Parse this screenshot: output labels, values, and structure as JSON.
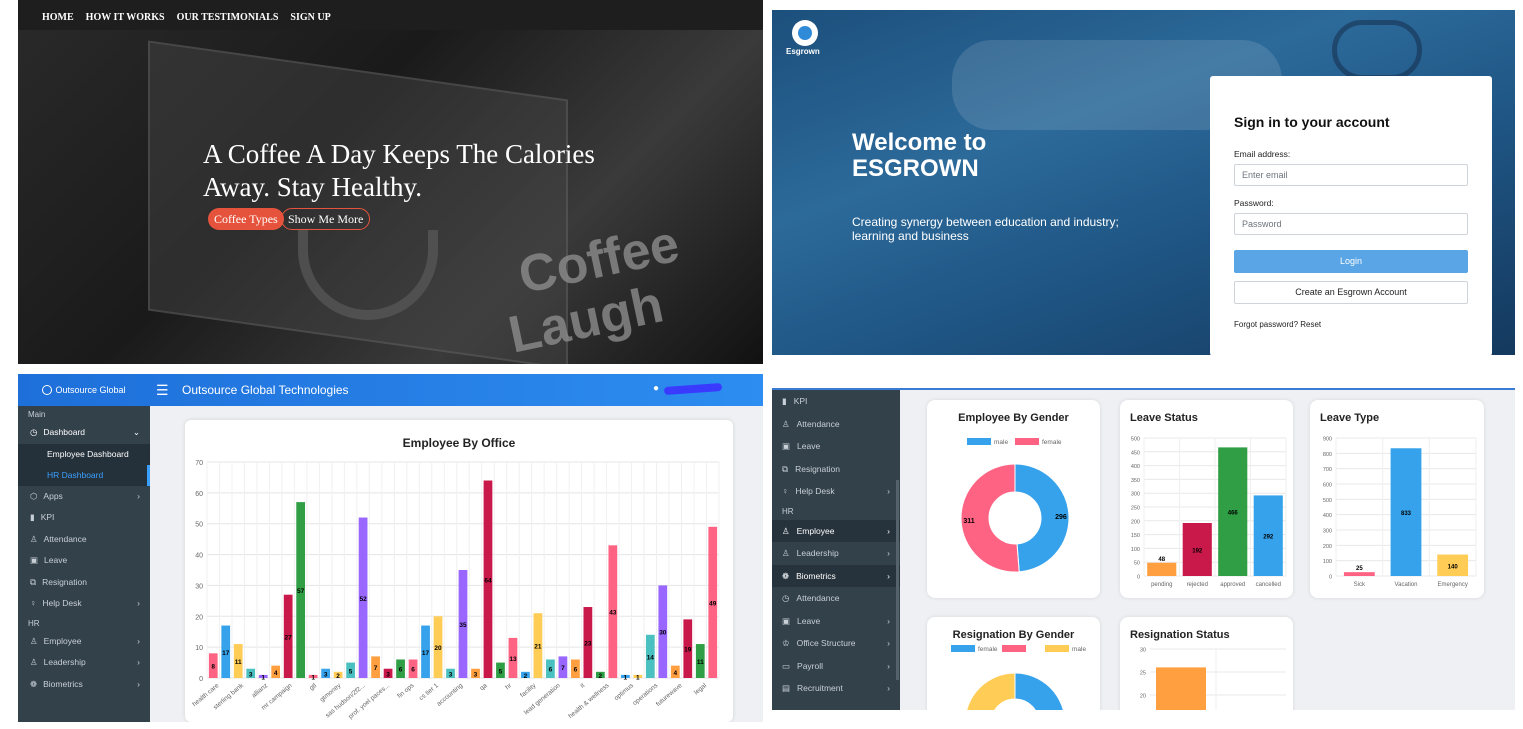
{
  "coffee": {
    "nav": [
      "HOME",
      "HOW IT WORKS",
      "OUR TESTIMONIALS",
      "SIGN UP"
    ],
    "headline": "A Coffee A Day Keeps The Calories Away. Stay Healthy.",
    "btn_primary": "Coffee Types",
    "btn_secondary": "Show Me More",
    "sign_line1": "Coffee",
    "sign_line2": "Laugh"
  },
  "login": {
    "brand": "Esgrown",
    "welcome": "Welcome to ESGROWN",
    "tagline": "Creating synergy between education and industry; learning and business",
    "card_title": "Sign in to your account",
    "email_label": "Email address:",
    "email_placeholder": "Enter email",
    "password_label": "Password:",
    "password_placeholder": "Password",
    "login_button": "Login",
    "create_button": "Create an Esgrown Account",
    "forgot": "Forgot password? Reset"
  },
  "dashboard": {
    "brand": "Outsource Global",
    "title": "Outsource Global Technologies",
    "sidebar": {
      "section_main": "Main",
      "dashboard": "Dashboard",
      "employee_dashboard": "Employee Dashboard",
      "hr_dashboard": "HR Dashboard",
      "apps": "Apps",
      "kpi": "KPI",
      "attendance": "Attendance",
      "leave": "Leave",
      "resignation": "Resignation",
      "help_desk": "Help Desk",
      "section_hr": "HR",
      "employee": "Employee",
      "leadership": "Leadership",
      "biometrics": "Biometrics"
    }
  },
  "hr": {
    "sidebar": {
      "kpi": "KPI",
      "attendance": "Attendance",
      "leave": "Leave",
      "resignation": "Resignation",
      "help_desk": "Help Desk",
      "section_hr": "HR",
      "employee": "Employee",
      "leadership": "Leadership",
      "biometrics": "Biometrics",
      "attendance2": "Attendance",
      "leave2": "Leave",
      "office_structure": "Office Structure",
      "payroll": "Payroll",
      "recruitment": "Recruitment"
    },
    "card_gender": "Employee By Gender",
    "card_leave_status": "Leave Status",
    "card_leave_type": "Leave Type",
    "card_resignation_gender": "Resignation By Gender",
    "card_resignation_status": "Resignation Status"
  },
  "chart_data": [
    {
      "type": "bar",
      "title": "Employee By Office",
      "ylim": [
        0,
        70
      ],
      "yticks": [
        0,
        10,
        20,
        30,
        40,
        50,
        60,
        70
      ],
      "categories": [
        "health care",
        "sterling bank",
        "allianz",
        "mr campaign",
        "gtl",
        "gtmoney",
        "sas hudson/2f2...",
        "prof. yoel paces...",
        "fin ops",
        "cs tier 1",
        "accounting",
        "qa",
        "hr",
        "facility",
        "lead generation",
        "it",
        "health & wellness",
        "optimus",
        "operations",
        "futurewave",
        "legal"
      ],
      "values": [
        8,
        17,
        11,
        3,
        1,
        4,
        27,
        57,
        1,
        3,
        2,
        5,
        52,
        7,
        3,
        6,
        6,
        17,
        20,
        3,
        35,
        3,
        64,
        5,
        13,
        2,
        21,
        6,
        7,
        6,
        23,
        2,
        43,
        1,
        1,
        14,
        30,
        4,
        19,
        11,
        49
      ],
      "colors": [
        "#ff6384",
        "#36a2eb",
        "#ffcd56",
        "#4bc0c0",
        "#9966ff",
        "#ff9f40",
        "#c9184a",
        "#2f9e44"
      ]
    },
    {
      "type": "pie",
      "title": "Employee By Gender",
      "series": [
        {
          "name": "male",
          "value": 296,
          "color": "#36a2eb"
        },
        {
          "name": "female",
          "value": 311,
          "color": "#ff6384"
        }
      ]
    },
    {
      "type": "bar",
      "title": "Leave Status",
      "categories": [
        "pending",
        "rejected",
        "approved",
        "cancelled"
      ],
      "values": [
        48,
        192,
        466,
        292
      ],
      "colors": [
        "#ff9f40",
        "#c9184a",
        "#2f9e44",
        "#36a2eb"
      ],
      "ylim": [
        0,
        500
      ],
      "yticks": [
        0,
        50,
        100,
        150,
        200,
        250,
        300,
        350,
        400,
        450,
        500
      ]
    },
    {
      "type": "bar",
      "title": "Leave Type",
      "categories": [
        "Sick",
        "Vacation",
        "Emergency"
      ],
      "values": [
        25,
        833,
        140
      ],
      "colors": [
        "#ff6384",
        "#36a2eb",
        "#ffcd56"
      ],
      "ylim": [
        0,
        900
      ],
      "yticks": [
        0,
        100,
        200,
        300,
        400,
        500,
        600,
        700,
        800,
        900
      ]
    },
    {
      "type": "pie",
      "title": "Resignation By Gender",
      "legend": [
        "female",
        "",
        "male"
      ],
      "label_visible": "13",
      "colors": [
        "#36a2eb",
        "#ff6384",
        "#ffcd56"
      ]
    },
    {
      "type": "bar",
      "title": "Resignation Status",
      "yticks_visible": [
        20,
        25,
        30
      ],
      "visible_bar_value": 26,
      "color": "#ff9f40"
    }
  ]
}
